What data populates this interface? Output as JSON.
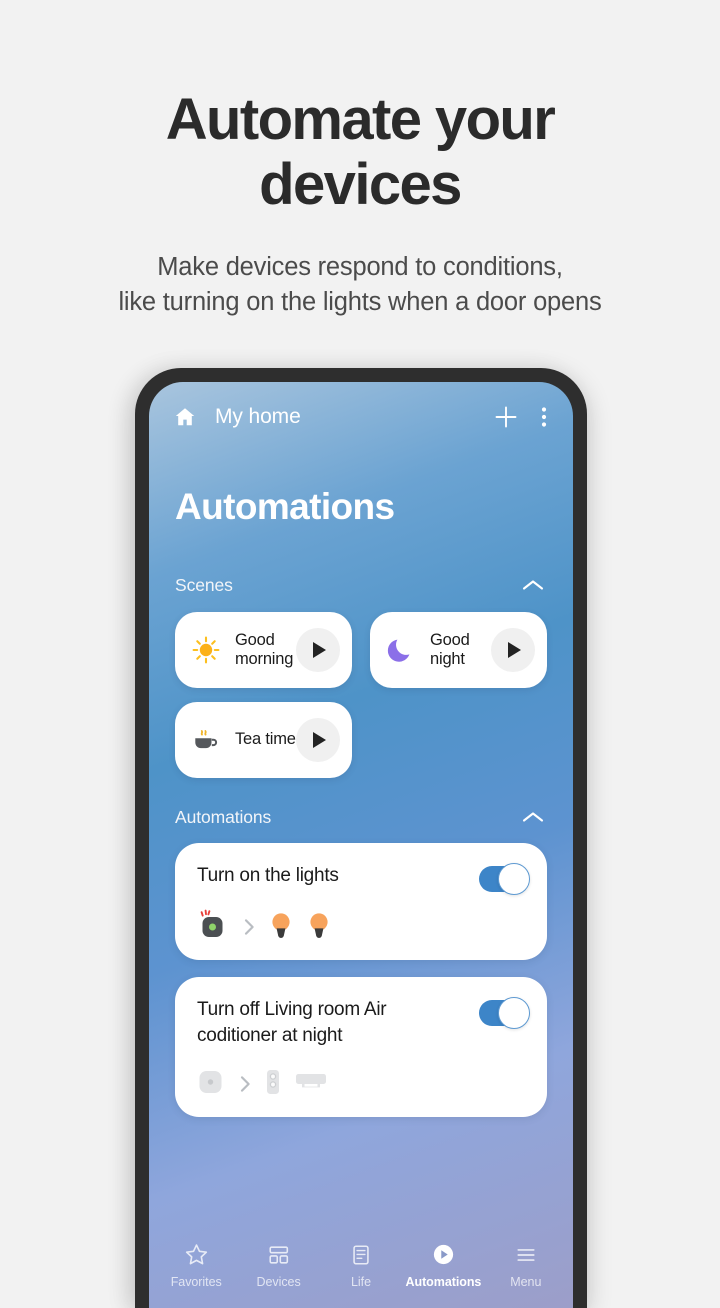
{
  "promo": {
    "title_line1": "Automate your",
    "title_line2": "devices",
    "subtitle_line1": "Make devices respond to conditions,",
    "subtitle_line2": "like turning on the lights when a door opens"
  },
  "app_bar": {
    "home_icon": "home-icon",
    "title": "My home",
    "add_icon": "plus-icon",
    "more_icon": "overflow-menu-icon"
  },
  "page": {
    "title": "Automations"
  },
  "sections": {
    "scenes": {
      "label": "Scenes",
      "collapse_icon": "chevron-up-icon"
    },
    "automations": {
      "label": "Automations",
      "collapse_icon": "chevron-up-icon"
    }
  },
  "scenes": [
    {
      "name": "Good morning",
      "icon": "sun-icon",
      "play_icon": "play-icon"
    },
    {
      "name": "Good night",
      "icon": "crescent-moon-icon",
      "play_icon": "play-icon"
    },
    {
      "name": "Tea time",
      "icon": "teacup-icon",
      "play_icon": "play-icon"
    }
  ],
  "automations": [
    {
      "name": "Turn on the lights",
      "enabled": "on",
      "trigger_icon": "motion-sensor-icon",
      "arrow_icon": "chevron-right-icon",
      "action_icons": [
        "light-bulb-icon",
        "light-bulb-icon"
      ]
    },
    {
      "name": "Turn off Living room Air coditioner at night",
      "enabled": "on",
      "trigger_icon": "sensor-icon",
      "arrow_icon": "chevron-right-icon",
      "action_icons": [
        "remote-control-icon",
        "air-conditioner-icon"
      ]
    }
  ],
  "bottom_nav": [
    {
      "label": "Favorites",
      "icon": "star-icon",
      "active": false
    },
    {
      "label": "Devices",
      "icon": "grid-icon",
      "active": false
    },
    {
      "label": "Life",
      "icon": "article-icon",
      "active": false
    },
    {
      "label": "Automations",
      "icon": "play-circle-icon",
      "active": true
    },
    {
      "label": "Menu",
      "icon": "hamburger-menu-icon",
      "active": false
    }
  ],
  "colors": {
    "page_background": "#f2f2f2",
    "accent_blue": "#3d85c8",
    "screen_top": "#a9c5de",
    "screen_mid": "#4e93c8",
    "screen_bottom": "#9c9ec9",
    "card_white": "#ffffff",
    "bulb_orange": "#f3a14e"
  }
}
